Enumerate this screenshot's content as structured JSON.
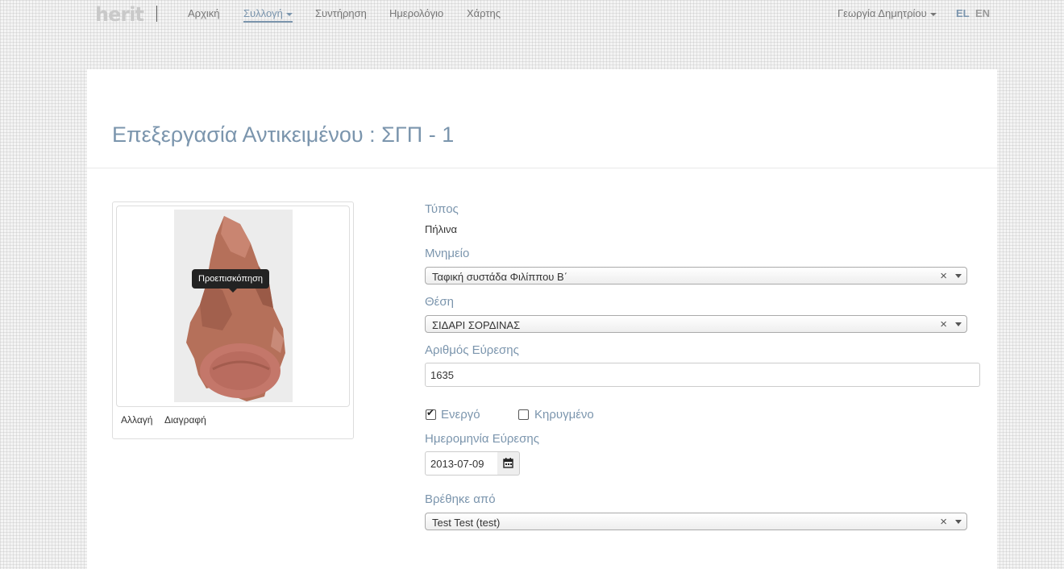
{
  "nav": {
    "logo": "herit",
    "items": [
      {
        "label": "Αρχική"
      },
      {
        "label": "Συλλογή"
      },
      {
        "label": "Συντήρηση"
      },
      {
        "label": "Ημερολόγιο"
      },
      {
        "label": "Χάρτης"
      }
    ],
    "user": "Γεωργία Δημητρίου",
    "lang_el": "EL",
    "lang_en": "EN"
  },
  "page": {
    "title": "Επεξεργασία Αντικειμένου : ΣΓΠ - 1"
  },
  "image_card": {
    "tooltip": "Προεπισκόπηση",
    "change_label": "Αλλαγή",
    "delete_label": "Διαγραφή"
  },
  "form": {
    "type_label": "Τύπος",
    "type_value": "Πήλινα",
    "monument_label": "Μνημείο",
    "monument_value": "Ταφική συστάδα Φιλίππου Β΄",
    "position_label": "Θέση",
    "position_value": "ΣΙΔΑΡΙ ΣΟΡΔΙΝΑΣ",
    "find_number_label": "Αριθμός Εύρεσης",
    "find_number_value": "1635",
    "active_label": "Ενεργό",
    "active_checked": true,
    "declared_label": "Κηρυγμένο",
    "declared_checked": false,
    "find_date_label": "Ημερομηνία Εύρεσης",
    "find_date_value": "2013-07-09",
    "found_by_label": "Βρέθηκε από",
    "found_by_value": "Test Test (test)"
  }
}
